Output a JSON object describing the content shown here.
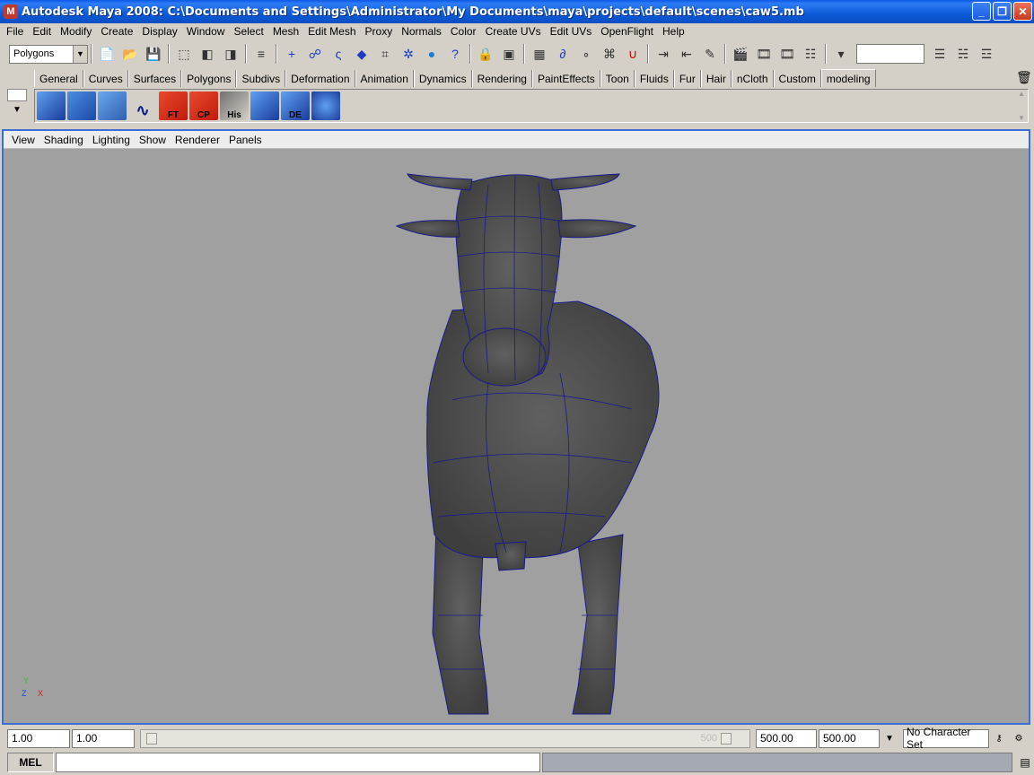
{
  "window": {
    "title": "Autodesk Maya 2008: C:\\Documents and Settings\\Administrator\\My Documents\\maya\\projects\\default\\scenes\\caw5.mb",
    "minimize": "_",
    "maximize": "❐",
    "close": "✕"
  },
  "menubar": [
    "File",
    "Edit",
    "Modify",
    "Create",
    "Display",
    "Window",
    "Select",
    "Mesh",
    "Edit Mesh",
    "Proxy",
    "Normals",
    "Color",
    "Create UVs",
    "Edit UVs",
    "OpenFlight",
    "Help"
  ],
  "statusline": {
    "mode": "Polygons"
  },
  "shelf_tabs": [
    "General",
    "Curves",
    "Surfaces",
    "Polygons",
    "Subdivs",
    "Deformation",
    "Animation",
    "Dynamics",
    "Rendering",
    "PaintEffects",
    "Toon",
    "Fluids",
    "Fur",
    "Hair",
    "nCloth",
    "Custom",
    "modeling"
  ],
  "active_shelf_tab": "modeling",
  "shelf_buttons": [
    {
      "label": "",
      "icon": "poly-cube-icon"
    },
    {
      "label": "",
      "icon": "poly-plane-icon"
    },
    {
      "label": "",
      "icon": "select-tool-icon"
    },
    {
      "label": "",
      "icon": "curve-tool-icon"
    },
    {
      "label": "FT",
      "icon": "freeze-transform-icon"
    },
    {
      "label": "CP",
      "icon": "center-pivot-icon"
    },
    {
      "label": "His",
      "icon": "delete-history-icon"
    },
    {
      "label": "",
      "icon": "uv-layout-icon"
    },
    {
      "label": "DE",
      "icon": "display-edges-icon"
    },
    {
      "label": "",
      "icon": "extrude-icon"
    }
  ],
  "viewport": {
    "menu": [
      "View",
      "Shading",
      "Lighting",
      "Show",
      "Renderer",
      "Panels"
    ],
    "axis_y": "Y",
    "axis_z": "Z",
    "axis_x": "X"
  },
  "timerange": {
    "start": "1.00",
    "playback_start": "1.00",
    "slider_end_label": "500",
    "playback_end": "500.00",
    "end": "500.00",
    "character_set": "No Character Set"
  },
  "commandline": {
    "label": "MEL",
    "value": ""
  },
  "colors": {
    "title_blue": "#0a58e6",
    "viewport_bg": "#a0a0a0",
    "wire_blue": "#1a1a8c",
    "mesh_gray": "#4a4a4a"
  }
}
